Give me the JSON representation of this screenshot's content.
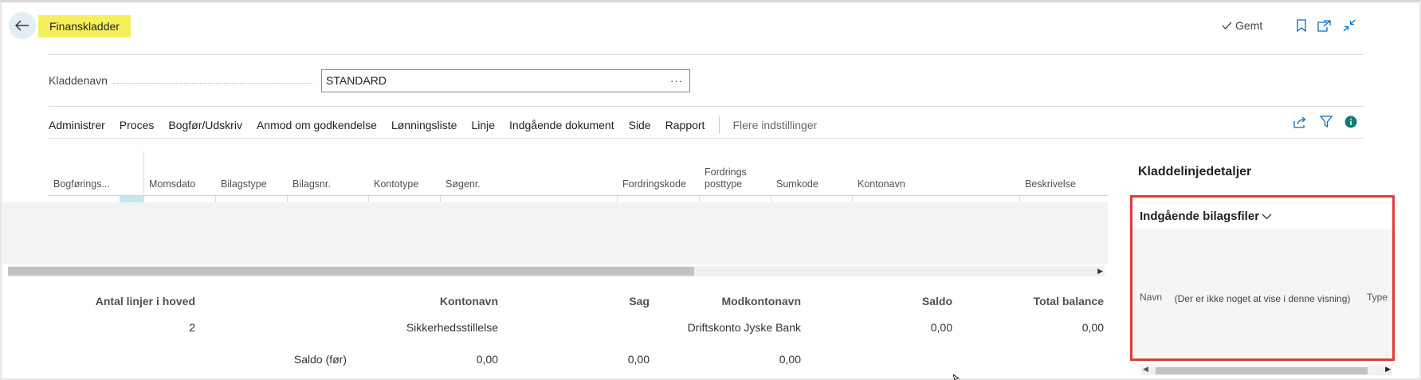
{
  "header": {
    "title": "Finanskladder",
    "saved_label": "Gemt"
  },
  "icons": {
    "back": "arrow-left-icon",
    "bookmark": "bookmark-icon",
    "open_new": "open-in-new-window-icon",
    "collapse": "collapse-icon",
    "share": "share-icon",
    "filter": "filter-icon",
    "info": "info-icon"
  },
  "colors": {
    "title_highlight": "#f5f05a",
    "panel_highlight": "#e03c3c",
    "info_accent": "#0f7c74",
    "back_button_bg": "#e3eef2"
  },
  "batch": {
    "label": "Kladdenavn",
    "value": "STANDARD",
    "lookup": "···"
  },
  "actions": {
    "items": [
      "Administrer",
      "Proces",
      "Bogfør/Udskriv",
      "Anmod om godkendelse",
      "Lønningsliste",
      "Linje",
      "Indgående dokument",
      "Side",
      "Rapport"
    ],
    "more": "Flere indstillinger"
  },
  "grid": {
    "columns": [
      "Bogførings...",
      "Momsdato",
      "Bilagstype",
      "Bilagsnr.",
      "Kontotype",
      "Søgenr.",
      "Fordringskode",
      "Fordrings posttype",
      "Sumkode",
      "Kontonavn",
      "Beskrivelse"
    ]
  },
  "summary": {
    "labels": {
      "lines": "Antal linjer i hoved",
      "account_name": "Kontonavn",
      "job": "Sag",
      "bal_account_name": "Modkontonavn",
      "balance": "Saldo",
      "total_balance": "Total balance"
    },
    "values": {
      "lines": "2",
      "account_name": "Sikkerhedsstillelse",
      "bal_account_name": "Driftskonto Jyske Bank",
      "balance": "0,00",
      "total_balance": "0,00"
    },
    "before": {
      "label": "Saldo (før)",
      "account": "0,00",
      "job": "0,00",
      "bal_account": "0,00"
    }
  },
  "details_panel": {
    "title": "Kladdelinjedetaljer",
    "section": "Indgående bilagsfiler",
    "col_name": "Navn",
    "col_type": "Type",
    "empty": "(Der er ikke noget at vise i denne visning)"
  }
}
